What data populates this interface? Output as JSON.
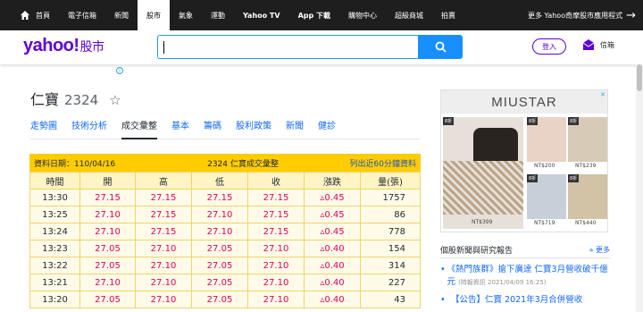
{
  "topbar": {
    "items": [
      "首頁",
      "電子信箱",
      "新聞",
      "股市",
      "氣象",
      "運動",
      "Yahoo TV",
      "App 下載",
      "購物中心",
      "超級商城",
      "拍賣"
    ],
    "active_index": 3,
    "more_label": "更多 Yahoo奇摩股市應用程式"
  },
  "header": {
    "logo": "yahoo!",
    "logo_sub": "股市",
    "search_value": "",
    "login_label": "登入",
    "mail_label": "信箱"
  },
  "ad_info_glyph": "i",
  "stock": {
    "name": "仁寶",
    "code": "2324"
  },
  "tabs": [
    "走勢圖",
    "技術分析",
    "成交彙整",
    "基本",
    "籌碼",
    "股利政策",
    "新聞",
    "健診"
  ],
  "active_tab": 2,
  "table": {
    "date_label": "資料日期：110/04/16",
    "title": "2324 仁寶成交彙整",
    "right_label": "列出近60分鐘資料",
    "columns": [
      "時間",
      "開",
      "高",
      "低",
      "收",
      "漲跌",
      "量(張)"
    ],
    "rows": [
      [
        "13:30",
        "27.15",
        "27.15",
        "27.15",
        "27.15",
        "▵0.45",
        "1757"
      ],
      [
        "13:25",
        "27.10",
        "27.15",
        "27.10",
        "27.15",
        "▵0.45",
        "86"
      ],
      [
        "13:24",
        "27.10",
        "27.15",
        "27.10",
        "27.15",
        "▵0.45",
        "778"
      ],
      [
        "13:23",
        "27.05",
        "27.10",
        "27.05",
        "27.10",
        "▵0.40",
        "154"
      ],
      [
        "13:22",
        "27.05",
        "27.10",
        "27.05",
        "27.10",
        "▵0.40",
        "314"
      ],
      [
        "13:21",
        "27.10",
        "27.10",
        "27.05",
        "27.10",
        "▵0.40",
        "227"
      ],
      [
        "13:20",
        "27.05",
        "27.10",
        "27.05",
        "27.10",
        "▵0.40",
        "43"
      ]
    ]
  },
  "ad": {
    "brand": "MIUSTAR",
    "close_glyph": "✕",
    "badge": "8折",
    "prices": [
      "NT$399",
      "NT$200",
      "NT$239",
      "NT$719",
      "NT$440"
    ]
  },
  "news": {
    "title": "個股新聞與研究報告",
    "more_label": "» 更多",
    "items": [
      {
        "text": "《熱門族群》搶下廣達 仁寶3月營收破千億元",
        "meta": "(時報資訊 2021/04/09 16:25)"
      },
      {
        "text": "【公告】仁寶 2021年3月合併營收",
        "meta": ""
      }
    ]
  },
  "colors": {
    "topbar_bg": "#1e1e1e",
    "brand_purple": "#6001d2",
    "search_blue": "#188fff",
    "table_header_yellow": "#ffcc00",
    "price_red": "#e0005a",
    "link_blue": "#0f69ff"
  },
  "icons": [
    "home-icon",
    "arrow-right-icon",
    "search-icon",
    "mail-icon",
    "star-outline-icon",
    "info-icon",
    "ad-close-icon"
  ]
}
